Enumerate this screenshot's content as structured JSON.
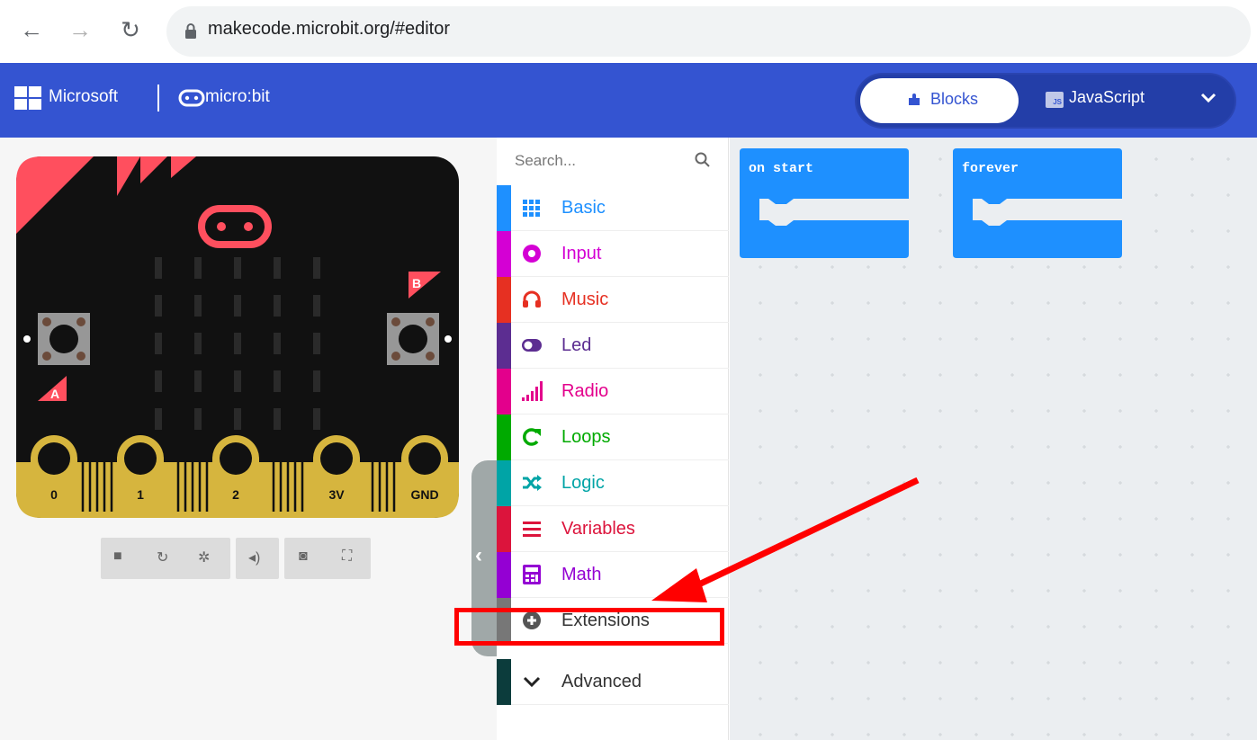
{
  "browser": {
    "url": "makecode.microbit.org/#editor"
  },
  "header": {
    "brand": "Microsoft",
    "product": "micro:bit",
    "tabs": {
      "blocks": "Blocks",
      "javascript": "JavaScript"
    }
  },
  "simulator": {
    "pins": [
      "0",
      "1",
      "2",
      "3V",
      "GND"
    ],
    "button_a": "A",
    "button_b": "B"
  },
  "toolbox": {
    "search_placeholder": "Search...",
    "categories": [
      {
        "label": "Basic",
        "color": "#1e90ff",
        "icon": "grid-icon"
      },
      {
        "label": "Input",
        "color": "#d400d4",
        "icon": "circle-target-icon"
      },
      {
        "label": "Music",
        "color": "#e63022",
        "icon": "headphones-icon"
      },
      {
        "label": "Led",
        "color": "#5c2d91",
        "icon": "toggle-icon"
      },
      {
        "label": "Radio",
        "color": "#e3008c",
        "icon": "signal-bars-icon"
      },
      {
        "label": "Loops",
        "color": "#00aa00",
        "icon": "loop-arrow-icon"
      },
      {
        "label": "Logic",
        "color": "#00a4a6",
        "icon": "shuffle-icon"
      },
      {
        "label": "Variables",
        "color": "#dc143c",
        "icon": "list-lines-icon"
      },
      {
        "label": "Math",
        "color": "#9400d3",
        "icon": "calculator-icon"
      },
      {
        "label": "Extensions",
        "color": "#777777",
        "icon": "plus-circle-icon"
      },
      {
        "label": "Advanced",
        "color": "#0c3c3c",
        "icon": "chevron-down-icon"
      }
    ]
  },
  "workspace": {
    "blocks": [
      {
        "label": "on start",
        "color": "#1e90ff"
      },
      {
        "label": "forever",
        "color": "#1e90ff"
      }
    ]
  }
}
